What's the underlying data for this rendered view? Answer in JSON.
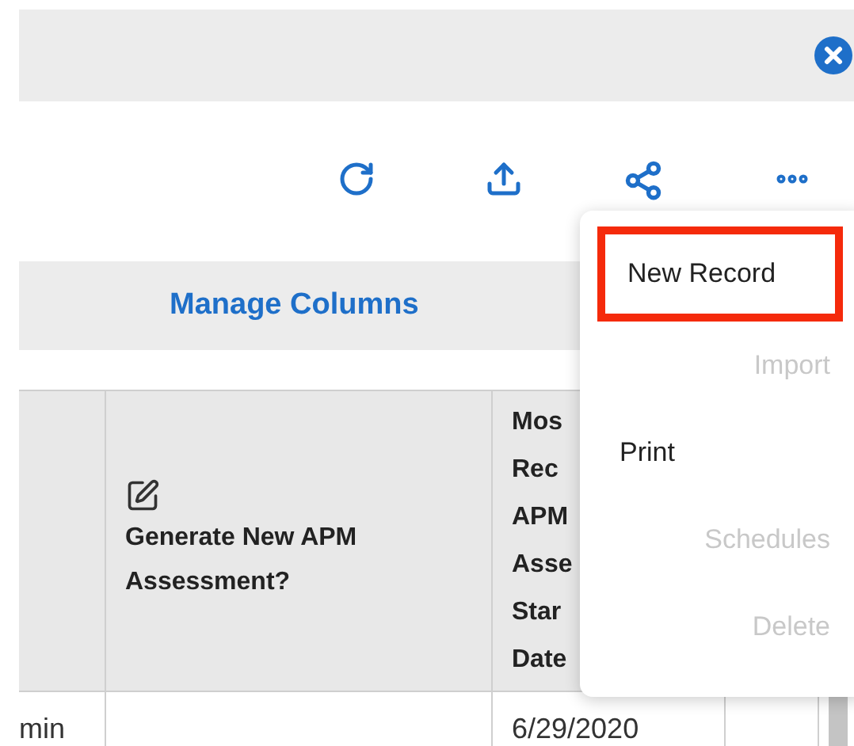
{
  "toolbar": {
    "manage_columns": "Manage Columns"
  },
  "table": {
    "columns": [
      {
        "kind": "blank"
      },
      {
        "kind": "editable",
        "label": "Generate New APM Assessment?"
      },
      {
        "kind": "covered",
        "lines": [
          "Mos",
          "Rec",
          "APM",
          "Asse",
          "Star",
          "Date"
        ]
      },
      {
        "kind": "blank"
      }
    ],
    "rows": [
      {
        "cells": [
          {
            "text": "min"
          },
          {},
          {
            "text": "6/29/2020"
          },
          {}
        ]
      }
    ]
  },
  "menu": {
    "items": [
      {
        "label": "New Record",
        "disabled": false,
        "highlighted": true
      },
      {
        "label": "Import",
        "disabled": true,
        "highlighted": false
      },
      {
        "label": "Print",
        "disabled": false,
        "highlighted": false
      },
      {
        "label": "Schedules",
        "disabled": true,
        "highlighted": false
      },
      {
        "label": "Delete",
        "disabled": true,
        "highlighted": false
      }
    ]
  }
}
